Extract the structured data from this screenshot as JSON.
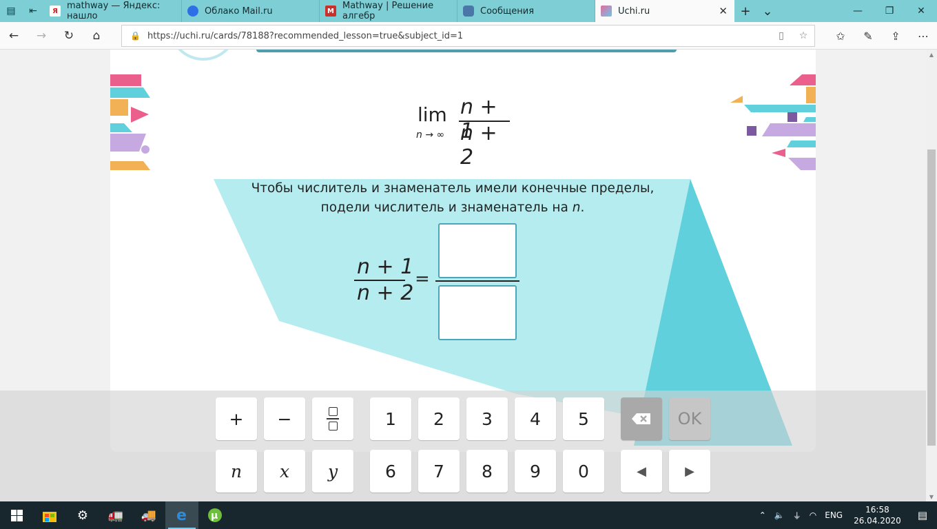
{
  "browser": {
    "tabs": [
      {
        "title": "mathway — Яндекс: нашло",
        "fav_text": "Я",
        "fav_color": "#e8e8e8"
      },
      {
        "title": "Облако Mail.ru",
        "fav_text": "",
        "fav_color": "#2f6fe5"
      },
      {
        "title": "Mathway | Решение алгебр",
        "fav_text": "M",
        "fav_color": "#c9302c"
      },
      {
        "title": "Сообщения",
        "fav_text": "",
        "fav_color": "#4a76a8"
      },
      {
        "title": "Uchi.ru",
        "fav_text": "",
        "fav_color": "#e86b9c"
      }
    ],
    "url": "https://uchi.ru/cards/78188?recommended_lesson=true&subject_id=1"
  },
  "task": {
    "limit_word": "lim",
    "limit_sub": "n → ∞",
    "numerator": "n + 1",
    "denominator": "n + 2",
    "hint_line1": "Чтобы числитель и знаменатель имели конечные пределы,",
    "hint_line2_prefix": "подели числитель и знаменатель на ",
    "hint_var": "n",
    "hint_line2_suffix": ".",
    "equals": "="
  },
  "keypad": {
    "plus": "+",
    "minus": "−",
    "d1": "1",
    "d2": "2",
    "d3": "3",
    "d4": "4",
    "d5": "5",
    "d6": "6",
    "d7": "7",
    "d8": "8",
    "d9": "9",
    "d0": "0",
    "var_n": "n",
    "var_x": "x",
    "var_y": "y",
    "ok": "OK",
    "left": "◀",
    "right": "▶"
  },
  "taskbar": {
    "lang": "ENG",
    "time": "16:58",
    "date": "26.04.2020"
  },
  "colors": {
    "tab_bar": "#7dcfd5",
    "light_teal": "#b4ecef",
    "mid_teal": "#5fd0dc",
    "answer_border": "#4ca6b8"
  }
}
